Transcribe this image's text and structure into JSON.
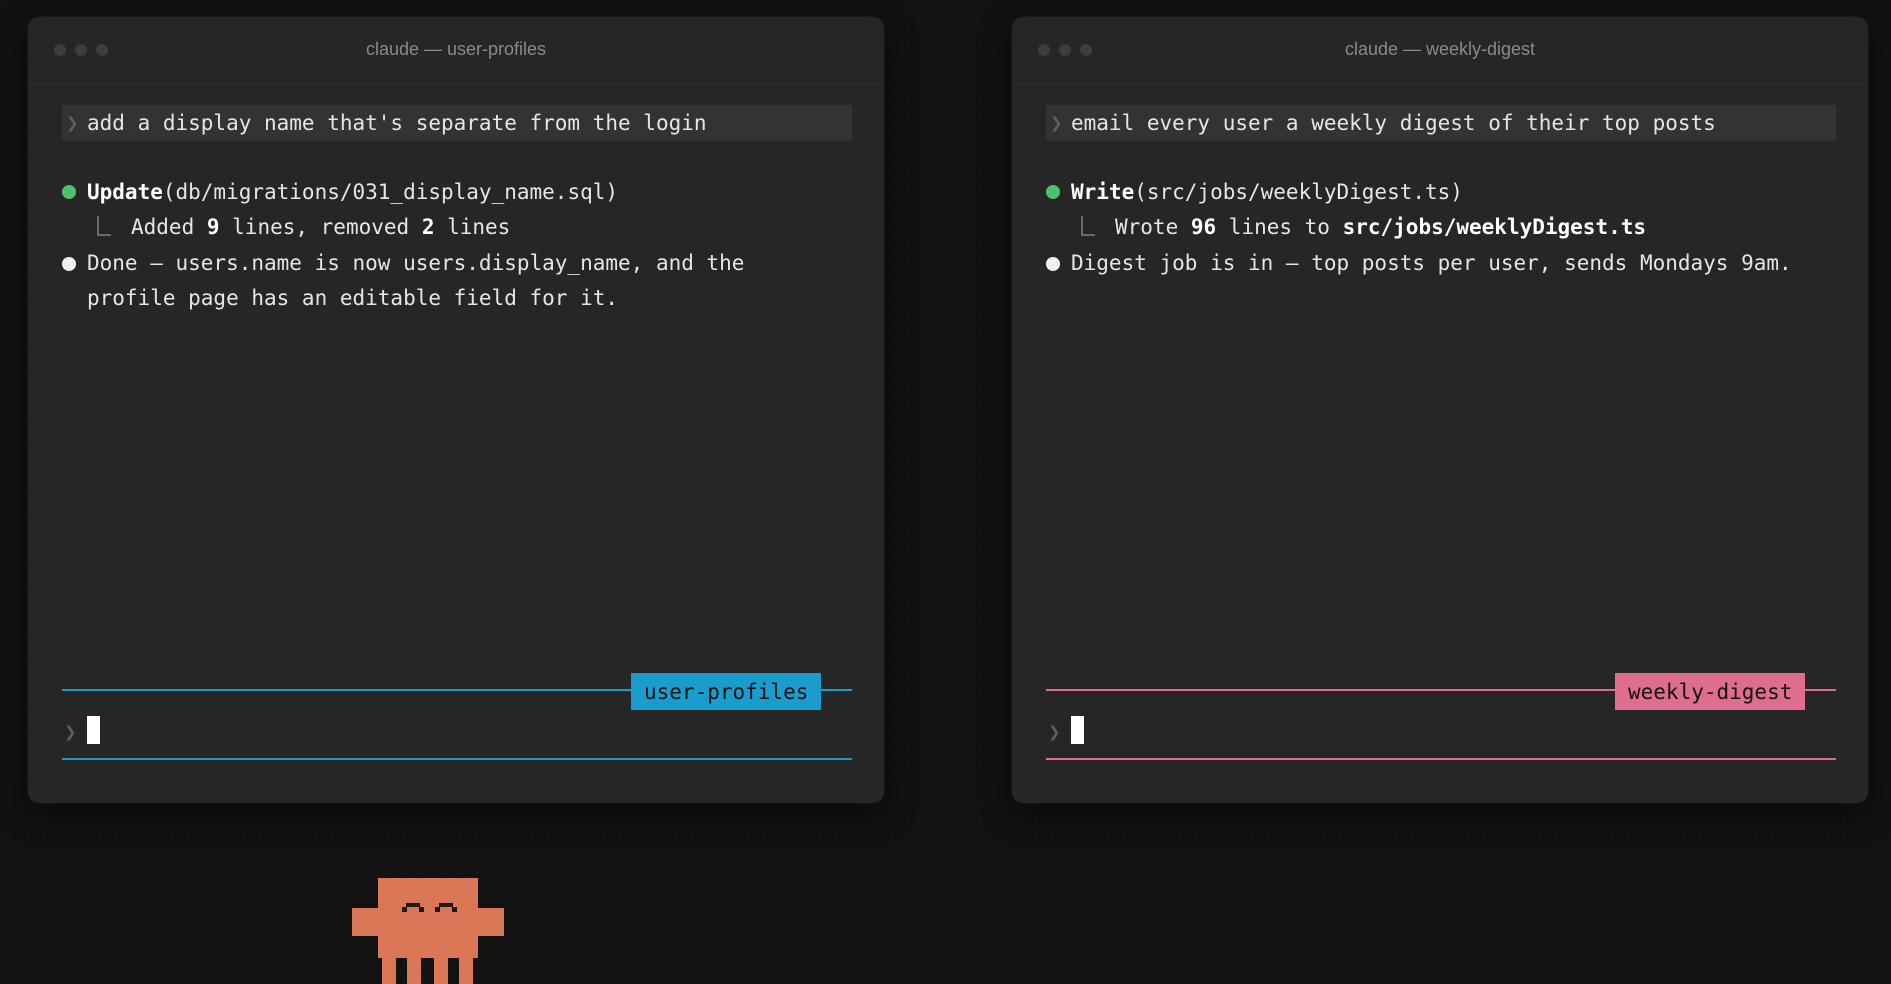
{
  "colors": {
    "left_accent": "#1a9ccd",
    "right_accent": "#df6d8c",
    "bullet_green": "#4cc36a",
    "mascot": "#d97757"
  },
  "windows": [
    {
      "title": "claude — user-profiles",
      "prompt": "add a display name that's separate from the login",
      "tool": {
        "name": "Update",
        "args": "(db/migrations/031_display_name.sql)",
        "result_pre": "Added ",
        "result_num1": "9",
        "result_mid": " lines, removed ",
        "result_num2": "2",
        "result_post": " lines"
      },
      "message_line1": "Done — users.name is now users.display_name, and the",
      "message_line2": "profile page has an editable field for it.",
      "tag": "user-profiles"
    },
    {
      "title": "claude — weekly-digest",
      "prompt": "email every user a weekly digest of their top posts",
      "tool": {
        "name": "Write",
        "args": "(src/jobs/weeklyDigest.ts)",
        "result_pre": "Wrote ",
        "result_num1": "96",
        "result_mid": " lines to ",
        "result_path": "src/jobs/weeklyDigest.ts"
      },
      "message_line1": "Digest job is in — top posts per user, sends Mondays 9am.",
      "tag": "weekly-digest"
    }
  ],
  "icons": {
    "prompt_chevron": "❯",
    "window_controls": "traffic-light-dots",
    "mascot": "pixel-mascot"
  }
}
